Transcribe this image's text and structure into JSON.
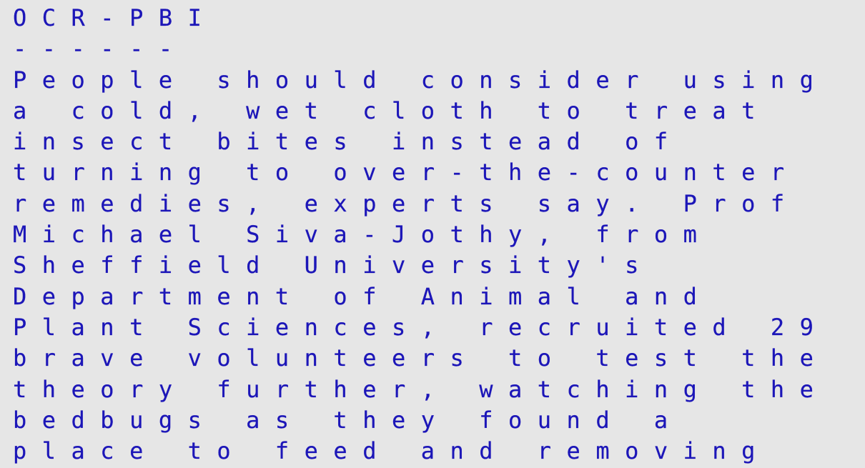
{
  "document": {
    "title": "OCR-PBI",
    "underline": "------",
    "lines": [
      "People should consider using",
      "a cold, wet cloth to treat",
      "insect bites instead of",
      "turning to over-the-counter",
      "remedies, experts say. Prof",
      "Michael Siva-Jothy, from",
      "Sheffield University's",
      "Department of Animal and",
      "Plant Sciences, recruited 29",
      "brave volunteers to test the",
      "theory further, watching the",
      "bedbugs as they found a",
      "place to feed and removing"
    ]
  },
  "colors": {
    "background": "#e6e6e6",
    "text": "#1c16b8"
  }
}
